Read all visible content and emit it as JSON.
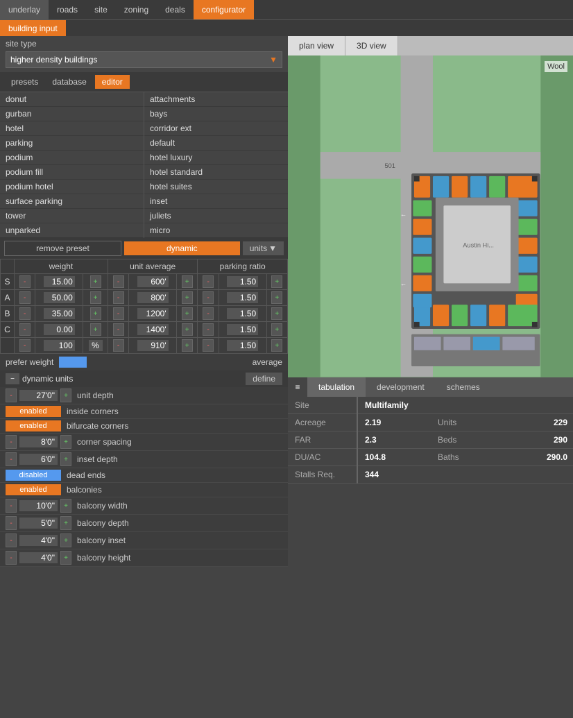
{
  "topNav": {
    "items": [
      {
        "id": "underlay",
        "label": "underlay",
        "active": false
      },
      {
        "id": "roads",
        "label": "roads",
        "active": false
      },
      {
        "id": "site",
        "label": "site",
        "active": false
      },
      {
        "id": "zoning",
        "label": "zoning",
        "active": false
      },
      {
        "id": "deals",
        "label": "deals",
        "active": false
      },
      {
        "id": "configurator",
        "label": "configurator",
        "active": true
      }
    ]
  },
  "subNav": {
    "items": [
      {
        "id": "building-input",
        "label": "building input",
        "active": true
      }
    ]
  },
  "siteType": {
    "label": "site type",
    "value": "higher density buildings"
  },
  "tabs": {
    "presets": "presets",
    "database": "database",
    "editor": "editor"
  },
  "presetsList": [
    "donut",
    "gurban",
    "hotel",
    "parking",
    "podium",
    "podium fill",
    "podium hotel",
    "surface parking",
    "tower",
    "unparked"
  ],
  "databaseList": [
    "attachments",
    "bays",
    "corridor ext",
    "default",
    "hotel luxury",
    "hotel standard",
    "hotel suites",
    "inset",
    "juliets",
    "micro"
  ],
  "presetActions": {
    "remove": "remove preset",
    "dynamic": "dynamic",
    "units": "units"
  },
  "weightTable": {
    "headers": [
      "weight",
      "unit average",
      "parking ratio"
    ],
    "rows": [
      {
        "label": "S",
        "weight": "15.00",
        "unitAvg": "600'",
        "parkingRatio": "1.50"
      },
      {
        "label": "A",
        "weight": "50.00",
        "unitAvg": "800'",
        "parkingRatio": "1.50"
      },
      {
        "label": "B",
        "weight": "35.00",
        "unitAvg": "1200'",
        "parkingRatio": "1.50"
      },
      {
        "label": "C",
        "weight": "0.00",
        "unitAvg": "1400'",
        "parkingRatio": "1.50"
      },
      {
        "label": "",
        "weight": "100",
        "unitAvg": "910'",
        "parkingRatio": "1.50"
      }
    ],
    "pctSign": "%"
  },
  "preferWeight": {
    "label": "prefer weight",
    "averageLabel": "average"
  },
  "dynamicUnits": {
    "title": "dynamic units",
    "defineBtn": "define",
    "rows": [
      {
        "type": "value",
        "minus": "-",
        "value": "27'0\"",
        "plus": "+",
        "desc": "unit depth"
      },
      {
        "type": "toggle",
        "state": "enabled",
        "desc": "inside corners"
      },
      {
        "type": "toggle",
        "state": "enabled",
        "desc": "bifurcate corners"
      },
      {
        "type": "value",
        "minus": "-",
        "value": "8'0\"",
        "plus": "+",
        "desc": "corner spacing"
      },
      {
        "type": "value",
        "minus": "-",
        "value": "6'0\"",
        "plus": "+",
        "desc": "inset depth"
      },
      {
        "type": "toggle",
        "state": "disabled",
        "desc": "dead ends"
      },
      {
        "type": "toggle",
        "state": "enabled",
        "desc": "balconies"
      },
      {
        "type": "value",
        "minus": "-",
        "value": "10'0\"",
        "plus": "+",
        "desc": "balcony width"
      },
      {
        "type": "value",
        "minus": "-",
        "value": "5'0\"",
        "plus": "+",
        "desc": "balcony depth"
      },
      {
        "type": "value",
        "minus": "-",
        "value": "4'0\"",
        "plus": "+",
        "desc": "balcony inset"
      },
      {
        "type": "value",
        "minus": "-",
        "value": "4'0\"",
        "plus": "+",
        "desc": "balcony height"
      }
    ]
  },
  "mapTabs": [
    {
      "id": "plan-view",
      "label": "plan view",
      "active": true
    },
    {
      "id": "3d-view",
      "label": "3D view",
      "active": false
    }
  ],
  "mapLabel": "Wool",
  "bottomTabs": [
    {
      "id": "tabulation",
      "label": "tabulation",
      "active": true
    },
    {
      "id": "development",
      "label": "development",
      "active": false
    },
    {
      "id": "schemes",
      "label": "schemes",
      "active": false
    }
  ],
  "stats": [
    {
      "label": "Site",
      "value": "Multifamily",
      "rightLabel": "",
      "rightValue": ""
    },
    {
      "label": "Acreage",
      "value": "2.19",
      "rightLabel": "Units",
      "rightValue": "229"
    },
    {
      "label": "FAR",
      "value": "2.3",
      "rightLabel": "Beds",
      "rightValue": "290"
    },
    {
      "label": "DU/AC",
      "value": "104.8",
      "rightLabel": "Baths",
      "rightValue": "290.0"
    },
    {
      "label": "Stalls Req.",
      "value": "344",
      "rightLabel": "",
      "rightValue": ""
    }
  ]
}
